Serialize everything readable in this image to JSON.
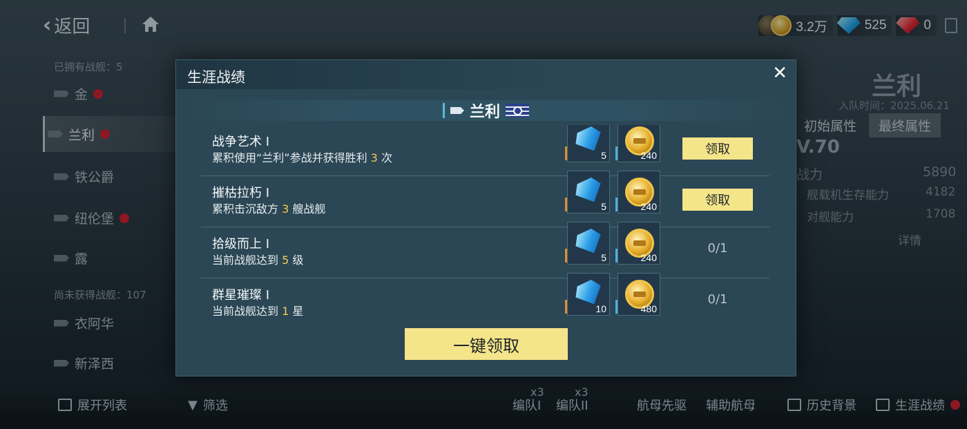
{
  "topbar": {
    "back_label": "返回"
  },
  "currency": {
    "gold": "3.2万",
    "diamond": "525",
    "ruby": "0"
  },
  "left": {
    "owned_label": "已拥有战舰：5",
    "owned_ships": [
      {
        "name": "金",
        "dot": true
      },
      {
        "name": "兰利",
        "dot": true
      },
      {
        "name": "铁公爵",
        "dot": false
      },
      {
        "name": "纽伦堡",
        "dot": true
      },
      {
        "name": "露",
        "dot": false
      }
    ],
    "unowned_label": "尚未获得战舰：107",
    "unowned_ships": [
      "衣阿华",
      "新泽西"
    ]
  },
  "bottom": {
    "expand": "展开列表",
    "filter": "筛选",
    "fleet1": "编队I",
    "fleet2": "编队II",
    "fleet1_count": "x3",
    "fleet2_count": "x3",
    "role1": "航母先驱",
    "role2": "辅助航母",
    "history": "历史背景",
    "career": "生涯战绩"
  },
  "right": {
    "ship_name": "兰利",
    "join_time": "入队时间：2025.06.21",
    "tab_initial": "初始属性",
    "tab_final": "最终属性",
    "level": "V.70",
    "power_label": "战力",
    "power_value": "5890",
    "stat1_label": "舰载机生存能力",
    "stat1_value": "4182",
    "stat2_label": "对舰能力",
    "stat2_value": "1708",
    "details": "详情"
  },
  "modal": {
    "title": "生涯战绩",
    "ship_name": "兰利",
    "claim_all": "一键领取",
    "tasks": [
      {
        "name": "战争艺术 I",
        "desc_pre": "累积使用“兰利”参战并获得胜利 ",
        "num": "3",
        "desc_post": " 次",
        "diamond": "5",
        "gold": "240",
        "action": "领取",
        "claimable": true
      },
      {
        "name": "摧枯拉朽 I",
        "desc_pre": "累积击沉敌方 ",
        "num": "3",
        "desc_post": " 艘战舰",
        "diamond": "5",
        "gold": "240",
        "action": "领取",
        "claimable": true
      },
      {
        "name": "拾级而上 I",
        "desc_pre": "当前战舰达到 ",
        "num": "5",
        "desc_post": " 级",
        "diamond": "5",
        "gold": "240",
        "action": "0/1",
        "claimable": false
      },
      {
        "name": "群星璀璨 I",
        "desc_pre": "当前战舰达到 ",
        "num": "1",
        "desc_post": " 星",
        "diamond": "10",
        "gold": "480",
        "action": "0/1",
        "claimable": false
      }
    ]
  },
  "colors": {
    "accent_yellow": "#f4e58a",
    "highlight_number": "#f5cc55",
    "modal_bg": "#2b4654",
    "red_dot": "#d51c2c"
  }
}
